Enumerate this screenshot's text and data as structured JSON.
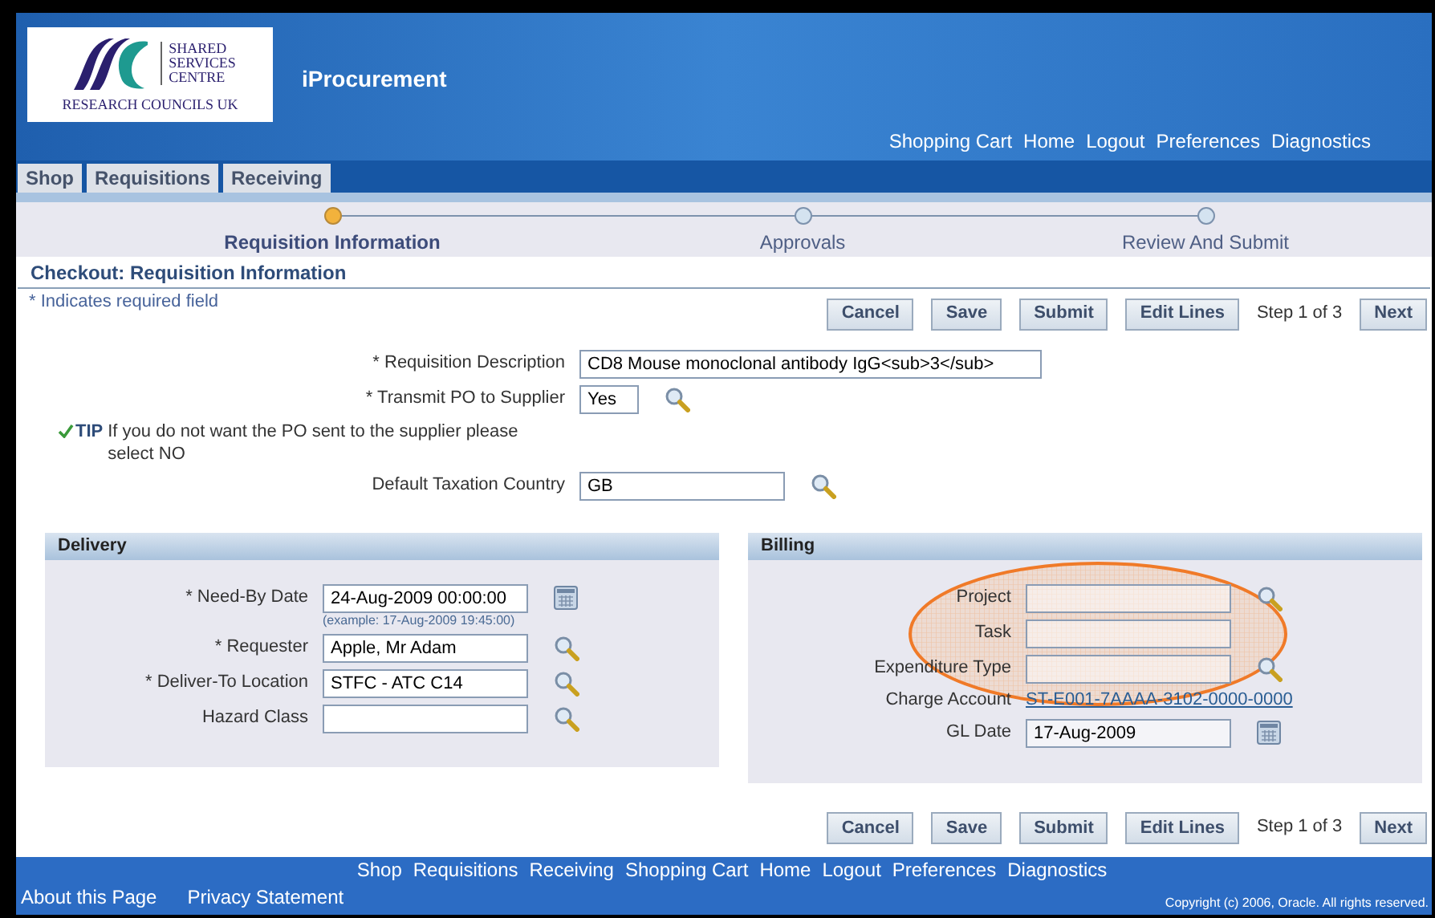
{
  "header": {
    "logo": {
      "lines": [
        "SHARED",
        "SERVICES",
        "CENTRE"
      ],
      "caption": "RESEARCH COUNCILS UK"
    },
    "app_title": "iProcurement",
    "global_links": [
      "Shopping Cart",
      "Home",
      "Logout",
      "Preferences",
      "Diagnostics"
    ]
  },
  "tabs": [
    {
      "label": "Shop",
      "selected": false
    },
    {
      "label": "Requisitions",
      "selected": false
    },
    {
      "label": "Receiving",
      "selected": false
    }
  ],
  "train": [
    {
      "label": "Requisition Information",
      "selected": true
    },
    {
      "label": "Approvals",
      "selected": false
    },
    {
      "label": "Review And Submit",
      "selected": false
    }
  ],
  "page_title": "Checkout: Requisition Information",
  "required_note": {
    "mark": "*",
    "text": "Indicates required field"
  },
  "top_actions": {
    "buttons": [
      "Cancel",
      "Save",
      "Submit",
      "Edit Lines"
    ],
    "step_text": "Step 1 of 3",
    "next_button": "Next"
  },
  "main_fields": [
    {
      "kind": "text",
      "label": "Requisition Description",
      "required": true,
      "value": "CD8 Mouse monoclonal antibody IgG<sub>3</sub>"
    },
    {
      "kind": "lookup",
      "label": "Transmit PO to Supplier",
      "required": true,
      "value": "Yes"
    },
    {
      "kind": "tip",
      "tip_label": "TIP",
      "text": "If you do not want the PO sent to the supplier please select NO"
    },
    {
      "kind": "lookup",
      "label": "Default Taxation Country",
      "required": false,
      "value": "GB"
    }
  ],
  "delivery": {
    "title": "Delivery",
    "fields": [
      {
        "kind": "date",
        "label": "Need-By Date",
        "required": true,
        "value": "24-Aug-2009 00:00:00",
        "hint": "(example: 17-Aug-2009 19:45:00)"
      },
      {
        "kind": "lookup",
        "label": "Requester",
        "required": true,
        "value": "Apple, Mr Adam"
      },
      {
        "kind": "lookup",
        "label": "Deliver-To Location",
        "required": true,
        "value": "STFC - ATC C14"
      },
      {
        "kind": "lookup",
        "label": "Hazard Class",
        "required": false
      }
    ]
  },
  "billing": {
    "title": "Billing",
    "fields": [
      {
        "kind": "lookup",
        "label": "Project",
        "required": false
      },
      {
        "kind": "text",
        "label": "Task",
        "required": false
      },
      {
        "kind": "lookup",
        "label": "Expenditure Type",
        "required": false
      },
      {
        "kind": "link",
        "label": "Charge Account",
        "required": false,
        "value": "ST-E001-7AAAA-3102-0000-0000"
      },
      {
        "kind": "date",
        "label": "GL Date",
        "required": false,
        "value": "17-Aug-2009"
      }
    ]
  },
  "bottom_actions": {
    "buttons": [
      "Cancel",
      "Save",
      "Submit",
      "Edit Lines"
    ],
    "step_text": "Step 1 of 3",
    "next_button": "Next"
  },
  "footer": {
    "links": [
      "Shop",
      "Requisitions",
      "Receiving",
      "Shopping Cart",
      "Home",
      "Logout",
      "Preferences",
      "Diagnostics"
    ],
    "bottom_links": [
      "About this Page",
      "Privacy Statement"
    ],
    "copyright": "Copyright (c) 2006, Oracle. All rights reserved."
  }
}
